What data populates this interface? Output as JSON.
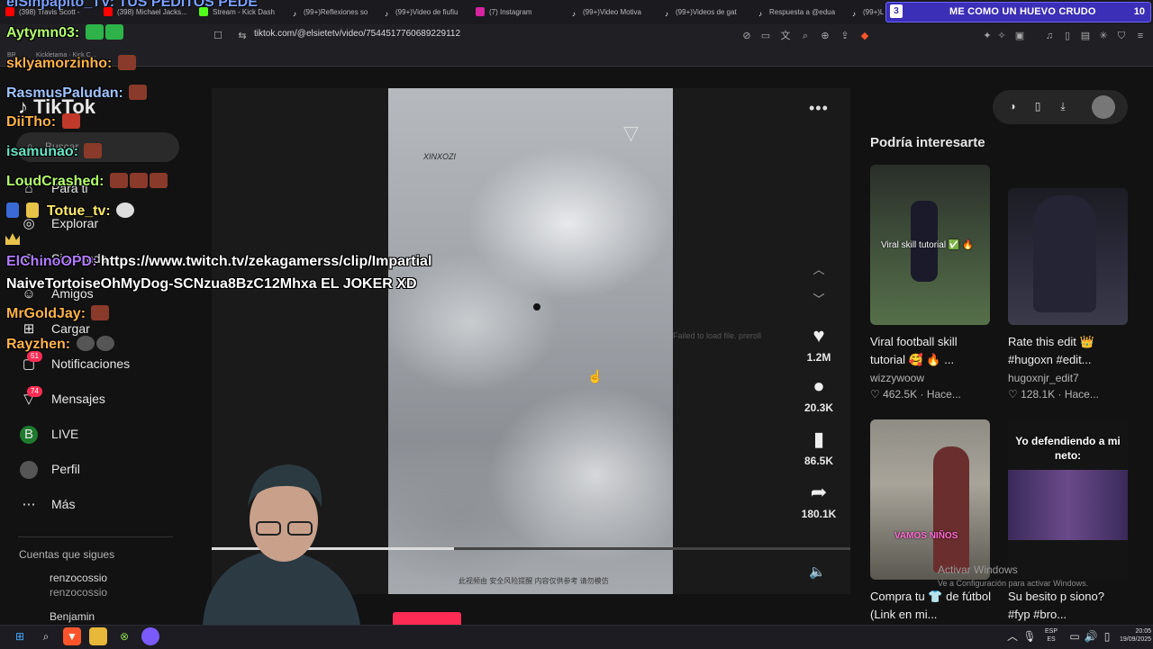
{
  "browser": {
    "tabs": [
      {
        "label": "(398) Travis Scott -",
        "icon": "youtube-icon"
      },
      {
        "label": "(398) Michael Jacks...",
        "icon": "youtube-icon"
      },
      {
        "label": "Stream - Kick Dash",
        "icon": "kick-icon"
      },
      {
        "label": "(99+)Reflexiones so",
        "icon": "tiktok-icon"
      },
      {
        "label": "(99+)Video de fiufiu",
        "icon": "tiktok-icon"
      },
      {
        "label": "(7) Instagram",
        "icon": "instagram-icon"
      },
      {
        "label": "(99+)Video Motiva",
        "icon": "tiktok-icon"
      },
      {
        "label": "(99+)Videos de gat",
        "icon": "tiktok-icon"
      },
      {
        "label": "Respuesta a @edua",
        "icon": "tiktok-icon"
      },
      {
        "label": "(99+)L",
        "icon": "tiktok-icon"
      }
    ],
    "url": "tiktok.com/@elsietetv/video/7544517760689229112",
    "bookmark": "Kickletama · Kick C...",
    "bookmark_prefix": "BR"
  },
  "stream_banner": {
    "position": "3",
    "song": "ME COMO UN HUEVO CRUDO",
    "count": "10",
    "overlay_title": "elSinpapito_TV: TUS PEDITOS PEDE"
  },
  "tiktok": {
    "logo": "TikTok",
    "search_placeholder": "Buscar",
    "nav": [
      {
        "label": "Para ti",
        "icon": "home-icon"
      },
      {
        "label": "Explorar",
        "icon": "compass-icon"
      },
      {
        "label": "Siguiendo",
        "icon": "following-icon"
      },
      {
        "label": "Amigos",
        "icon": "friends-icon"
      },
      {
        "label": "Cargar",
        "icon": "upload-icon"
      },
      {
        "label": "Notificaciones",
        "icon": "bell-icon",
        "badge": "51"
      },
      {
        "label": "Mensajes",
        "icon": "message-icon",
        "badge": "74"
      },
      {
        "label": "LIVE",
        "icon": "live-icon"
      },
      {
        "label": "Perfil",
        "icon": "profile-icon"
      },
      {
        "label": "Más",
        "icon": "more-icon"
      }
    ],
    "following_title": "Cuentas que sigues",
    "following": [
      {
        "name": "renzocossio",
        "handle": "renzocossio"
      },
      {
        "name": "Benjamin",
        "handle": ""
      }
    ],
    "video": {
      "watermark": "XINXOZI",
      "caption": "此视频由 安全风险提醒 内容仅供参考 请勿模仿",
      "failed_text": "Failed to load file. preroll",
      "progress": 0.38
    },
    "actions": [
      {
        "icon": "heart-icon",
        "count": "1.2M"
      },
      {
        "icon": "comment-icon",
        "count": "20.3K"
      },
      {
        "icon": "bookmark-icon",
        "count": "86.5K"
      },
      {
        "icon": "share-icon",
        "count": "180.1K"
      }
    ],
    "suggestions_title": "Podría interesarte",
    "suggestions": [
      {
        "title": "Viral football skill tutorial 🥰 🔥 ...",
        "author": "wizzywoow",
        "likes": "462.5K",
        "time": "Hace...",
        "thumb_text": "Viral skill tutorial ✅ 🔥"
      },
      {
        "title": "Rate this edit 👑 #hugoxn #edit...",
        "author": "hugoxnjr_edit7",
        "likes": "128.1K",
        "time": "Hace...",
        "thumb_text": ""
      },
      {
        "title": "Compra tu 👕 de fútbol (Link en mi...",
        "author": "",
        "likes": "",
        "time": "",
        "thumb_text": "VAMOS NIÑOS"
      },
      {
        "title": "Su besito p siono? #fyp #bro...",
        "author": "",
        "likes": "",
        "time": "",
        "thumb_text": "Yo defendiendo a mi neto:"
      }
    ]
  },
  "windows": {
    "activate_title": "Activar Windows",
    "activate_sub": "Ve a Configuración para activar Windows.",
    "lang": "ESP",
    "lang_region": "ES",
    "time": "20:05",
    "date": "19/09/2025"
  },
  "chat": [
    {
      "user": "Aytymn03:",
      "text": "",
      "color": "#b3ff6b",
      "emotes": 2
    },
    {
      "user": "sklyamorzinho:",
      "text": "",
      "color": "#ffb347",
      "emotes": 1
    },
    {
      "user": "RasmusPaludan:",
      "text": "",
      "color": "#9fc4ff",
      "emotes": 1
    },
    {
      "user": "DiiTho:",
      "text": "",
      "color": "#ffb347",
      "emotes": 1
    },
    {
      "user": "isamunao:",
      "text": "",
      "color": "#63e6c5",
      "emotes": 1
    },
    {
      "user": "LoudCrashed:",
      "text": "",
      "color": "#b3ff6b",
      "emotes": 3
    },
    {
      "user": "Totue_tv:",
      "text": "",
      "color": "#ffe96b",
      "emotes": 1
    },
    {
      "user": "ElChinoOPD:",
      "text": "https://www.twitch.tv/zekagamerss/clip/Impartial",
      "color": "#b17bff",
      "emotes": 0
    },
    {
      "user": "",
      "text": "NaiveTortoiseOhMyDog-SCNzua8BzC12Mhxa EL JOKER XD",
      "color": "#ffffff",
      "emotes": 0
    },
    {
      "user": "MrGoldJay:",
      "text": "",
      "color": "#ffb347",
      "emotes": 1
    },
    {
      "user": "Rayzhen:",
      "text": "",
      "color": "#ffb347",
      "emotes": 2
    }
  ],
  "colors": {
    "tiktok_red": "#fe2c55",
    "banner_purple": "#3b2fb8",
    "background": "#121212"
  }
}
